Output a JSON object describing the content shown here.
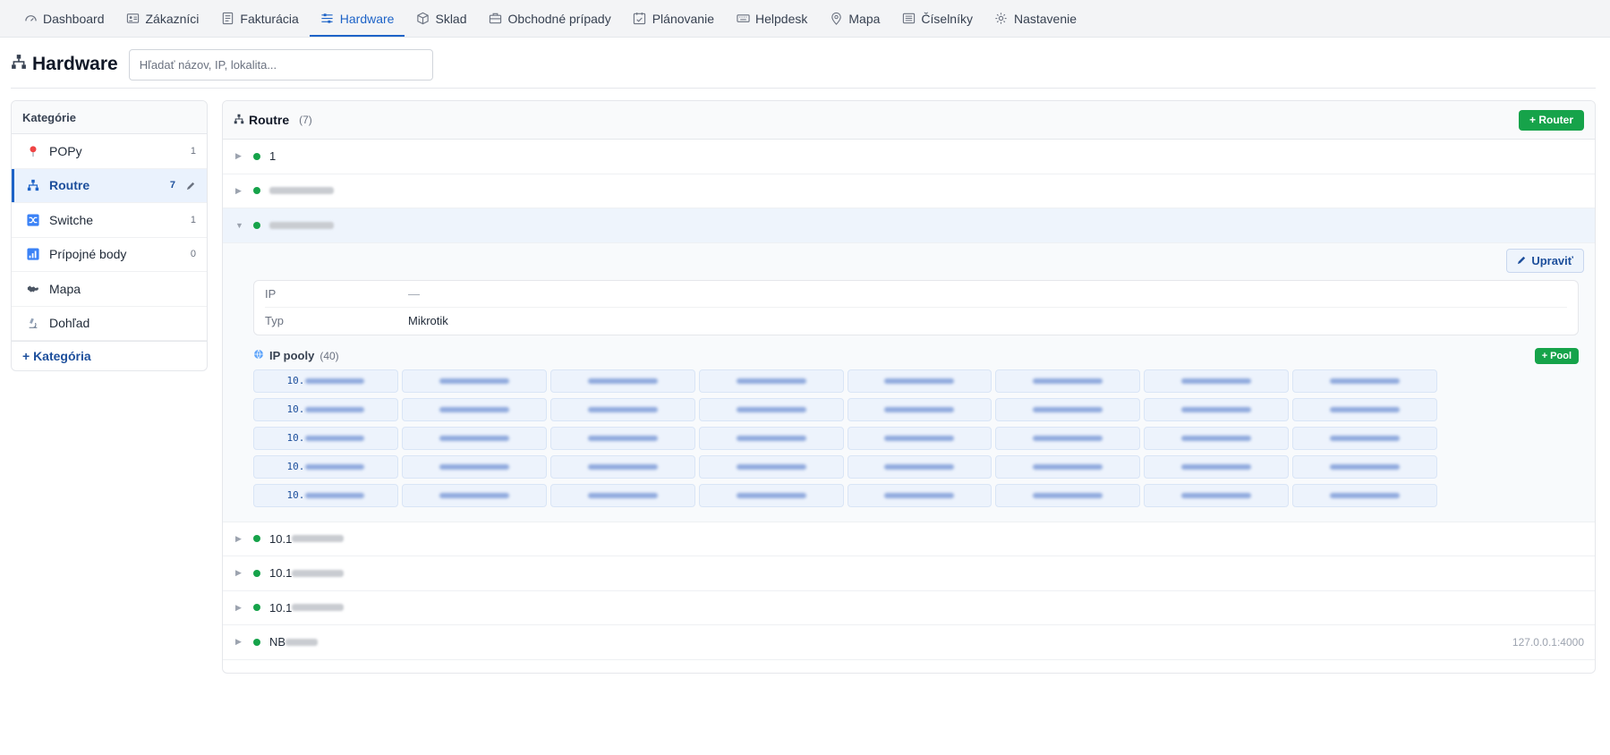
{
  "nav": {
    "items": [
      {
        "label": "Dashboard",
        "icon": "gauge-icon",
        "active": false
      },
      {
        "label": "Zákazníci",
        "icon": "id-card-icon",
        "active": false
      },
      {
        "label": "Fakturácia",
        "icon": "invoice-icon",
        "active": false
      },
      {
        "label": "Hardware",
        "icon": "sliders-icon",
        "active": true
      },
      {
        "label": "Sklad",
        "icon": "box-icon",
        "active": false
      },
      {
        "label": "Obchodné prípady",
        "icon": "briefcase-icon",
        "active": false
      },
      {
        "label": "Plánovanie",
        "icon": "calendar-check-icon",
        "active": false
      },
      {
        "label": "Helpdesk",
        "icon": "keyboard-icon",
        "active": false
      },
      {
        "label": "Mapa",
        "icon": "map-pin-icon",
        "active": false
      },
      {
        "label": "Číselníky",
        "icon": "list-icon",
        "active": false
      },
      {
        "label": "Nastavenie",
        "icon": "gear-icon",
        "active": false
      }
    ]
  },
  "page": {
    "title": "Hardware",
    "search_placeholder": "Hľadať názov, IP, lokalita..."
  },
  "sidebar": {
    "heading": "Kategórie",
    "items": [
      {
        "label": "POPy",
        "count": "1",
        "icon": "pin-icon",
        "active": false
      },
      {
        "label": "Routre",
        "count": "7",
        "icon": "network-icon",
        "active": true
      },
      {
        "label": "Switche",
        "count": "1",
        "icon": "shuffle-icon",
        "active": false
      },
      {
        "label": "Prípojné body",
        "count": "0",
        "icon": "signal-bars-icon",
        "active": false
      },
      {
        "label": "Mapa",
        "count": "",
        "icon": "world-map-icon",
        "active": false
      },
      {
        "label": "Dohľad",
        "count": "",
        "icon": "microscope-icon",
        "active": false
      }
    ],
    "add_label": "+ Kategória"
  },
  "panel": {
    "title": "Routre",
    "count": "(7)",
    "add_button": "+ Router",
    "rows": [
      {
        "name": "1",
        "blur_width": 0,
        "right": ""
      },
      {
        "name": "",
        "blur_width": 72,
        "right": ""
      },
      {
        "name": "",
        "blur_width": 72,
        "right": "",
        "expanded": true
      },
      {
        "name": "10.1",
        "blur_width": 58,
        "right": ""
      },
      {
        "name": "10.1",
        "blur_width": 58,
        "right": ""
      },
      {
        "name": "10.1",
        "blur_width": 58,
        "right": ""
      },
      {
        "name": "NB",
        "blur_width": 36,
        "right": "127.0.0.1:4000"
      }
    ],
    "detail": {
      "edit_button": "Upraviť",
      "info": [
        {
          "key": "IP",
          "value": "—"
        },
        {
          "key": "Typ",
          "value": "Mikrotik"
        }
      ],
      "pools_title": "IP pooly",
      "pools_count": "(40)",
      "add_pool": "+ Pool",
      "pool_prefix": "10.",
      "pool_rows": 5,
      "pool_cols": 8
    }
  }
}
